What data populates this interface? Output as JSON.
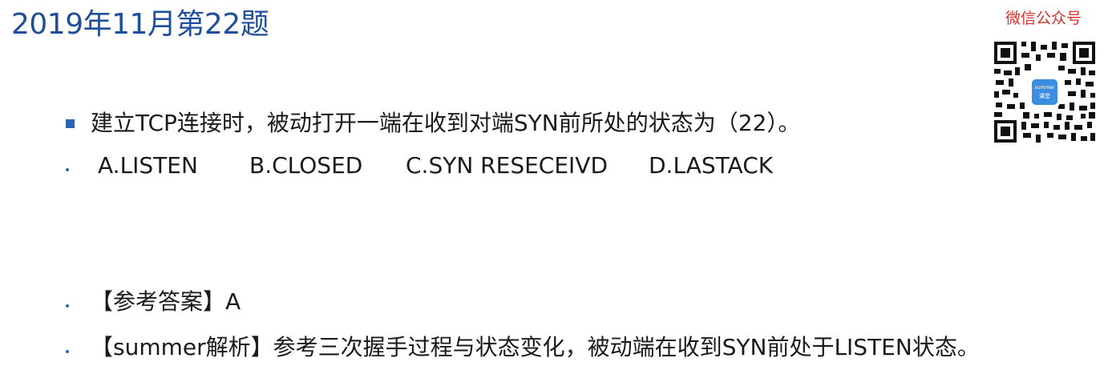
{
  "title": "2019年11月第22题",
  "wechat": {
    "label": "微信公众号",
    "qr_badge": "summer 课堂"
  },
  "question": {
    "stem": "建立TCP连接时，被动打开一端在收到对端SYN前所处的状态为（22）。",
    "options": [
      "A.LISTEN",
      "B.CLOSED",
      "C.SYN RESECEIVD",
      "D.LASTACK"
    ]
  },
  "answer": {
    "text": "【参考答案】A"
  },
  "analysis": {
    "text": "【summer解析】参考三次握手过程与状态变化，被动端在收到SYN前处于LISTEN状态。"
  },
  "colors": {
    "title": "#1f4e9c",
    "bullet": "#2e62b8",
    "wechat_label": "#d9302c"
  }
}
